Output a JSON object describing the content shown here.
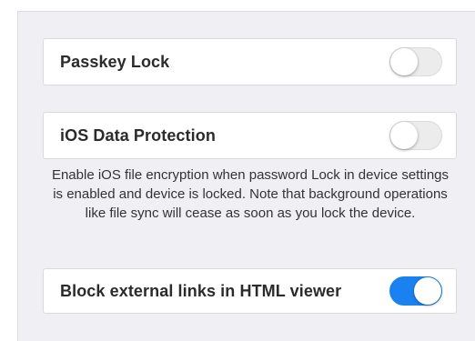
{
  "settings": {
    "passkey_lock": {
      "label": "Passkey Lock",
      "enabled": false
    },
    "ios_data_protection": {
      "label": "iOS Data Protection",
      "enabled": false,
      "footnote": "Enable iOS file encryption when password Lock in device settings is enabled and device is locked. Note that background operations like file sync will cease as soon as you lock the device."
    },
    "block_external_links": {
      "label": "Block external links in HTML viewer",
      "enabled": true
    }
  },
  "colors": {
    "toggle_on": "#1a82f0",
    "toggle_off": "#ececec",
    "background": "#efeff4"
  }
}
